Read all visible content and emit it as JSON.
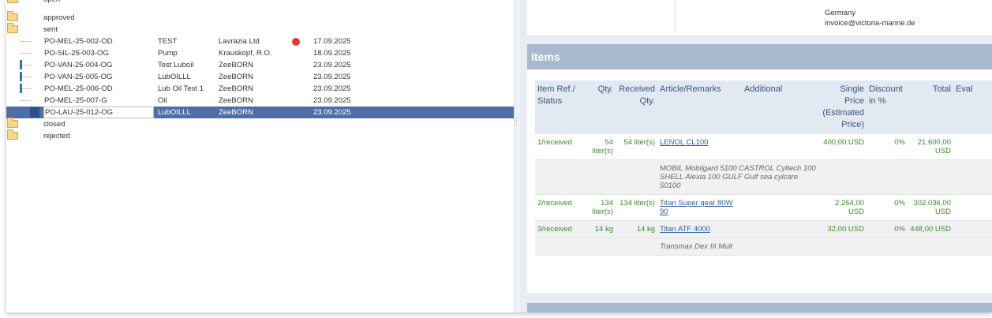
{
  "tree": {
    "folders_top": [
      {
        "label": "open"
      },
      {
        "label": "approved"
      },
      {
        "label": "sent"
      }
    ],
    "orders": [
      {
        "po": "PO-MEL-25-002-OD",
        "desc": "TEST",
        "vendor": "Lavrazia Ltd",
        "date": "17.09.2025",
        "flag": true,
        "bar": false,
        "dash": true
      },
      {
        "po": "PO-SIL-25-003-OG",
        "desc": "Pump",
        "vendor": "Krauskopf, R.O.",
        "date": "18.09.2025",
        "flag": false,
        "bar": false,
        "dash": true
      },
      {
        "po": "PO-VAN-25-004-OG",
        "desc": "Test Luboil",
        "vendor": "ZeeBORN",
        "date": "23.09.2025",
        "flag": false,
        "bar": true,
        "dash": true
      },
      {
        "po": "PO-VAN-25-005-OG",
        "desc": "LubOILLL",
        "vendor": "ZeeBORN",
        "date": "23.09.2025",
        "flag": false,
        "bar": true,
        "dash": true
      },
      {
        "po": "PO-MEL-25-006-OD",
        "desc": "Lub Oil Test 1",
        "vendor": "ZeeBORN",
        "date": "23.09.2025",
        "flag": false,
        "bar": true,
        "dash": true
      },
      {
        "po": "PO-MEL-25-007-G",
        "desc": "Oil",
        "vendor": "ZeeBORN",
        "date": "23.09.2025",
        "flag": false,
        "bar": false,
        "dash": true
      },
      {
        "po": "PO-LAU-25-012-OG",
        "desc": "LubOILLL",
        "vendor": "ZeeBORN",
        "date": "23.09.2025",
        "flag": false,
        "bar": true,
        "dash": false,
        "selected": true
      }
    ],
    "folders_bottom": [
      {
        "label": "closed"
      },
      {
        "label": "rejected"
      }
    ]
  },
  "address": {
    "country": "Germany",
    "email": "invoice@victoria-marine.de"
  },
  "items_panel": {
    "title": "Items",
    "columns": {
      "ref": "Item Ref./ Status",
      "qty": "Qty.",
      "received": "Received Qty.",
      "article": "Article/Remarks",
      "additional": "Additional",
      "price": "Single Price (Estimated Price)",
      "discount": "Discount in %",
      "total": "Total",
      "eval": "Eval"
    },
    "rows": [
      {
        "ref": "1/received",
        "qty": "54 liter(s)",
        "received": "54 liter(s)",
        "article": "LENOL CL100",
        "price": "400,00 USD",
        "discount": "0%",
        "total": "21.600,00 USD",
        "note": "MOBIL Mobilgard 5100 CASTROL Cyltech 100 SHELL Alexia 100 GULF Gulf sea cylcare 50100"
      },
      {
        "ref": "2/received",
        "qty": "134 liter(s)",
        "received": "134 liter(s)",
        "article": "Titan Super gear 80W 90",
        "price": "2.254,00 USD",
        "discount": "0%",
        "total": "302.036,00 USD",
        "note": ""
      },
      {
        "ref": "3/received",
        "qty": "14 kg",
        "received": "14 kg",
        "article": "Titan ATF 4000",
        "price": "32,00 USD",
        "discount": "0%",
        "total": "448,00 USD",
        "note": "Transmax Dex III Mult"
      }
    ]
  },
  "colors": {
    "header_blue": "#a7b8cf",
    "selection_blue": "#4d6fa6",
    "status_green": "#3c8a2a",
    "flag_red": "#e53935"
  }
}
